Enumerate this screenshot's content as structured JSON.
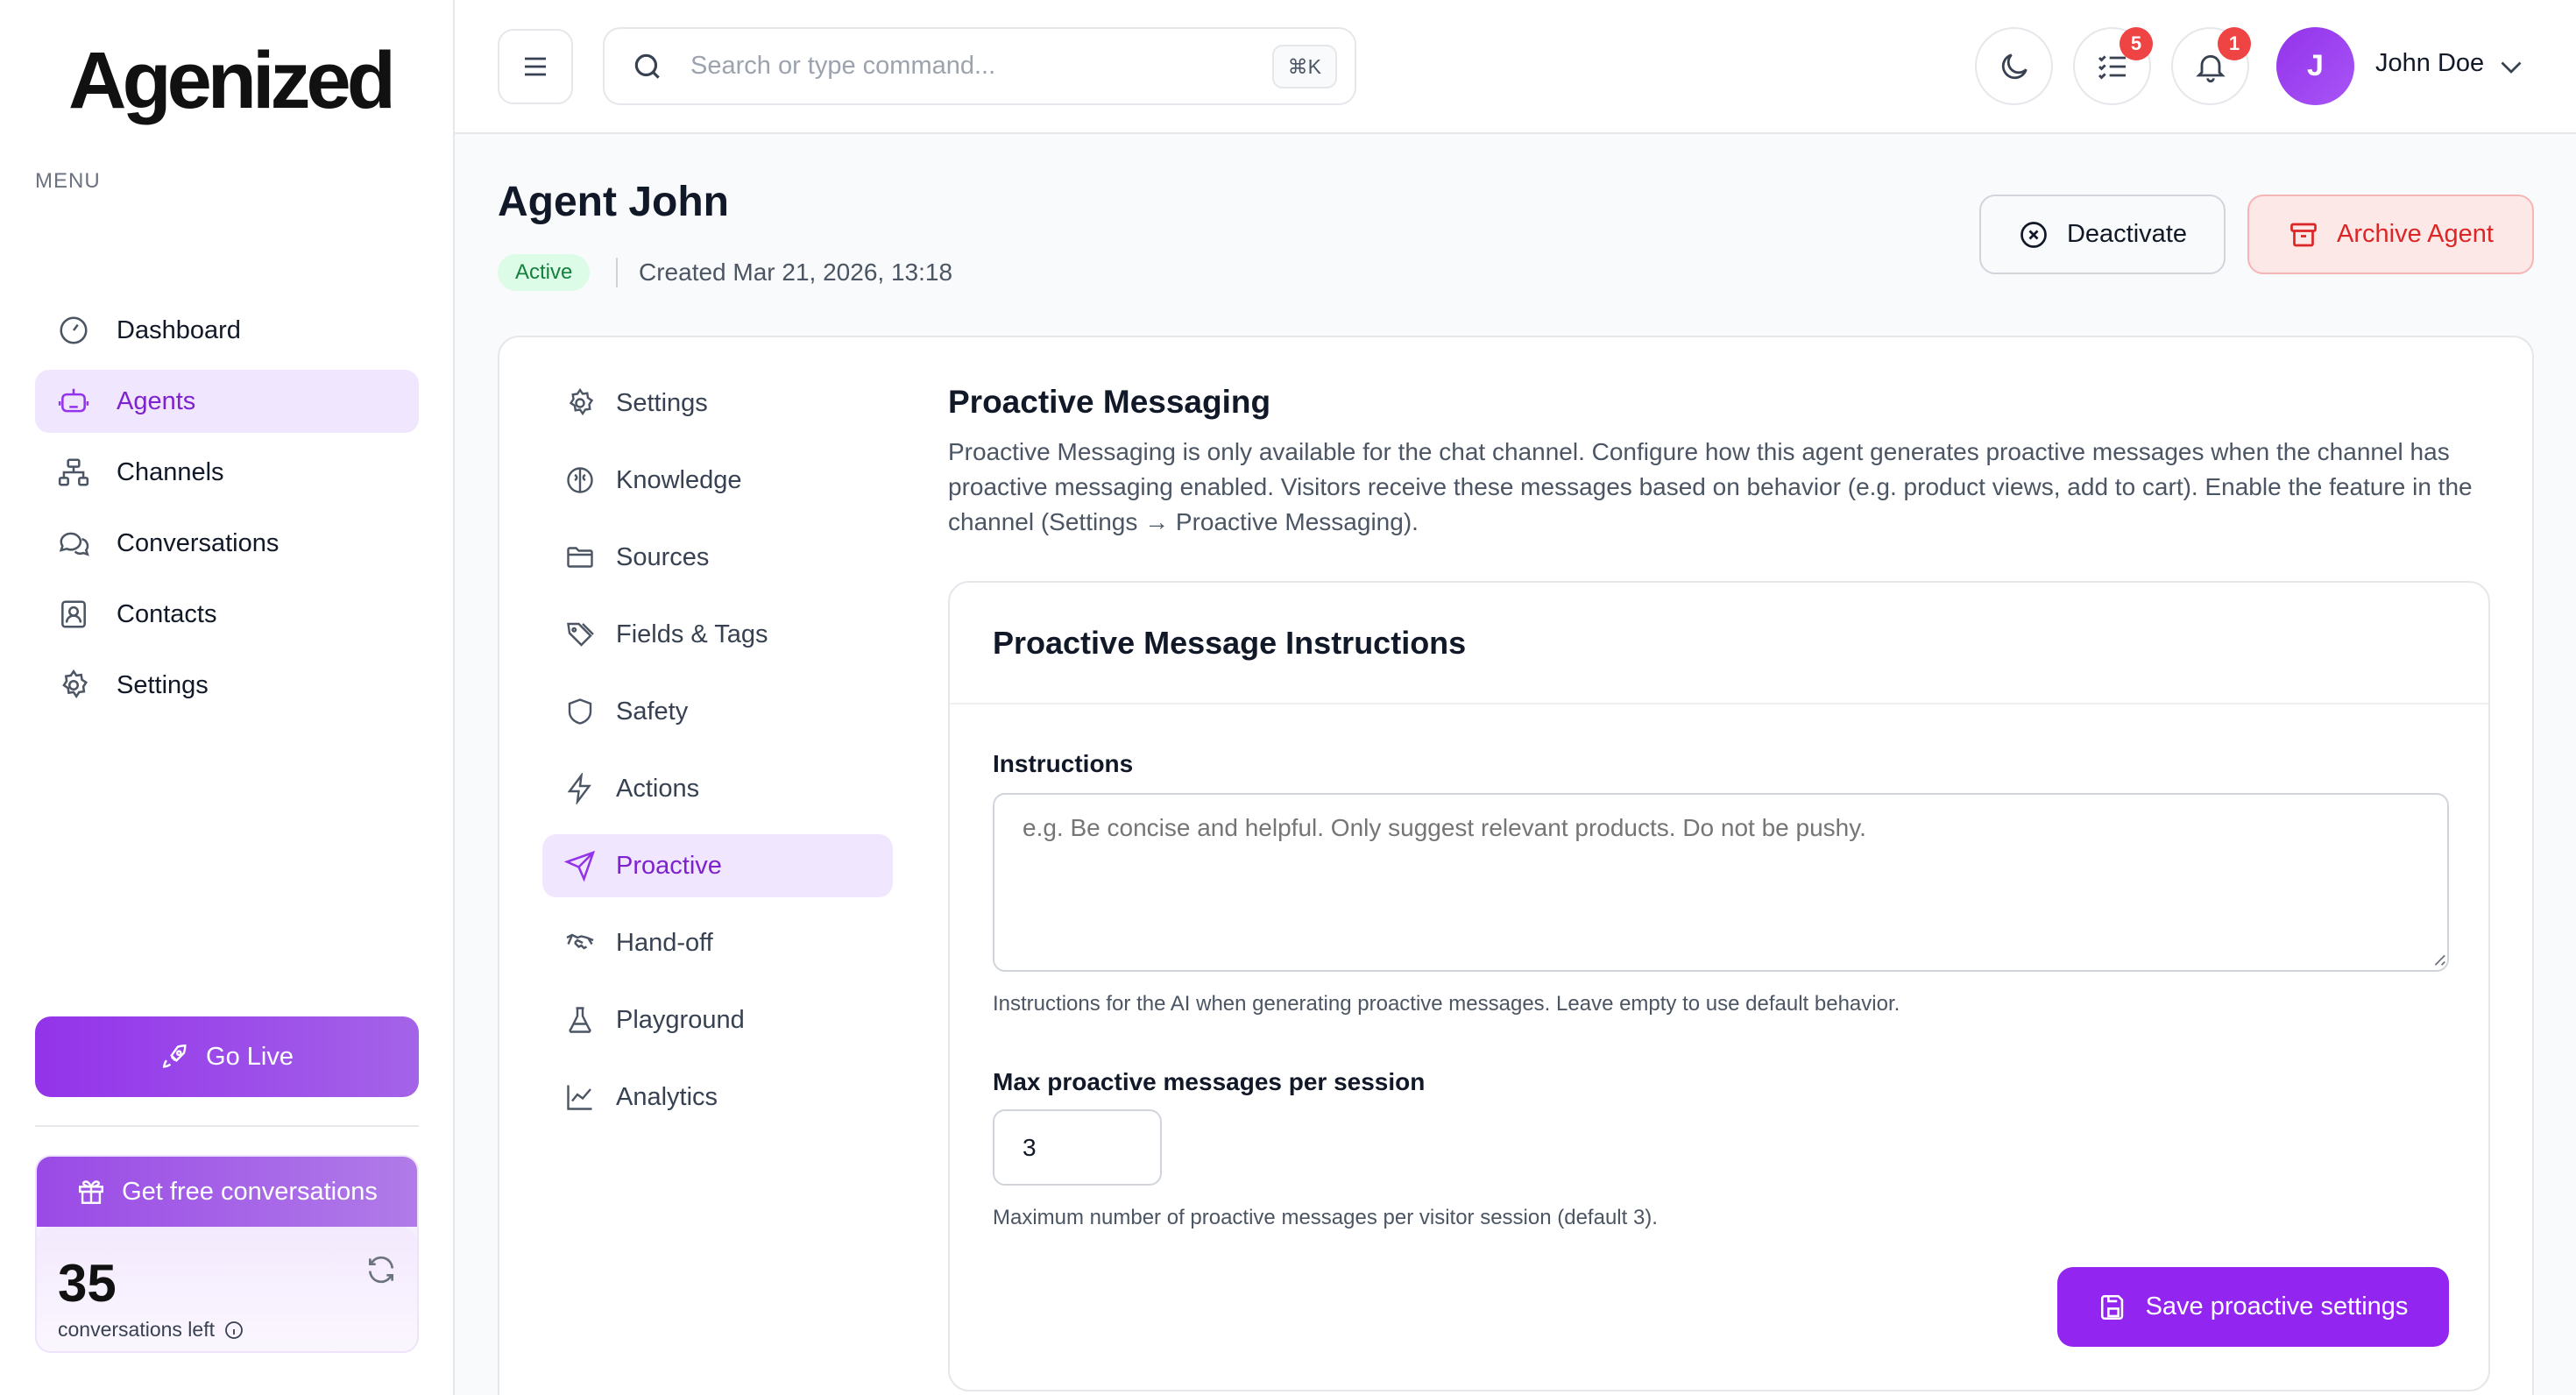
{
  "brand": {
    "logo_text": "Agenized",
    "accent": "#9333ea"
  },
  "sidebar": {
    "menu_label": "MENU",
    "items": [
      {
        "label": "Dashboard",
        "icon": "dashboard-gauge-icon",
        "active": false
      },
      {
        "label": "Agents",
        "icon": "robot-icon",
        "active": true
      },
      {
        "label": "Channels",
        "icon": "sitemap-icon",
        "active": false
      },
      {
        "label": "Conversations",
        "icon": "chat-bubbles-icon",
        "active": false
      },
      {
        "label": "Contacts",
        "icon": "contact-card-icon",
        "active": false
      },
      {
        "label": "Settings",
        "icon": "gear-icon",
        "active": false
      }
    ],
    "go_live": "Go Live",
    "free": {
      "header": "Get free conversations",
      "count": "35",
      "subtitle": "conversations left"
    }
  },
  "topbar": {
    "search_placeholder": "Search or type command...",
    "shortcut": "⌘K",
    "tasks_badge": "5",
    "notifications_badge": "1",
    "avatar_initial": "J",
    "user_name": "John Doe"
  },
  "page": {
    "title": "Agent John",
    "status": "Active",
    "created": "Created Mar 21, 2026, 13:18",
    "deactivate_label": "Deactivate",
    "archive_label": "Archive Agent"
  },
  "subnav": {
    "items": [
      {
        "label": "Settings",
        "icon": "gear-icon",
        "active": false
      },
      {
        "label": "Knowledge",
        "icon": "brain-icon",
        "active": false
      },
      {
        "label": "Sources",
        "icon": "folder-icon",
        "active": false
      },
      {
        "label": "Fields & Tags",
        "icon": "tags-icon",
        "active": false
      },
      {
        "label": "Safety",
        "icon": "shield-icon",
        "active": false
      },
      {
        "label": "Actions",
        "icon": "lightning-icon",
        "active": false
      },
      {
        "label": "Proactive",
        "icon": "send-icon",
        "active": true
      },
      {
        "label": "Hand-off",
        "icon": "handshake-icon",
        "active": false
      },
      {
        "label": "Playground",
        "icon": "flask-icon",
        "active": false
      },
      {
        "label": "Analytics",
        "icon": "line-chart-icon",
        "active": false
      }
    ]
  },
  "proactive": {
    "title": "Proactive Messaging",
    "description": "Proactive Messaging is only available for the chat channel. Configure how this agent generates proactive messages when the channel has proactive messaging enabled. Visitors receive these messages based on behavior (e.g. product views, add to cart). Enable the feature in the channel (Settings → Proactive Messaging).",
    "card_title": "Proactive Message Instructions",
    "instructions_label": "Instructions",
    "instructions_placeholder": "e.g. Be concise and helpful. Only suggest relevant products. Do not be pushy.",
    "instructions_value": "",
    "instructions_help": "Instructions for the AI when generating proactive messages. Leave empty to use default behavior.",
    "max_label": "Max proactive messages per session",
    "max_value": "3",
    "max_help": "Maximum number of proactive messages per visitor session (default 3).",
    "save_label": "Save proactive settings"
  }
}
